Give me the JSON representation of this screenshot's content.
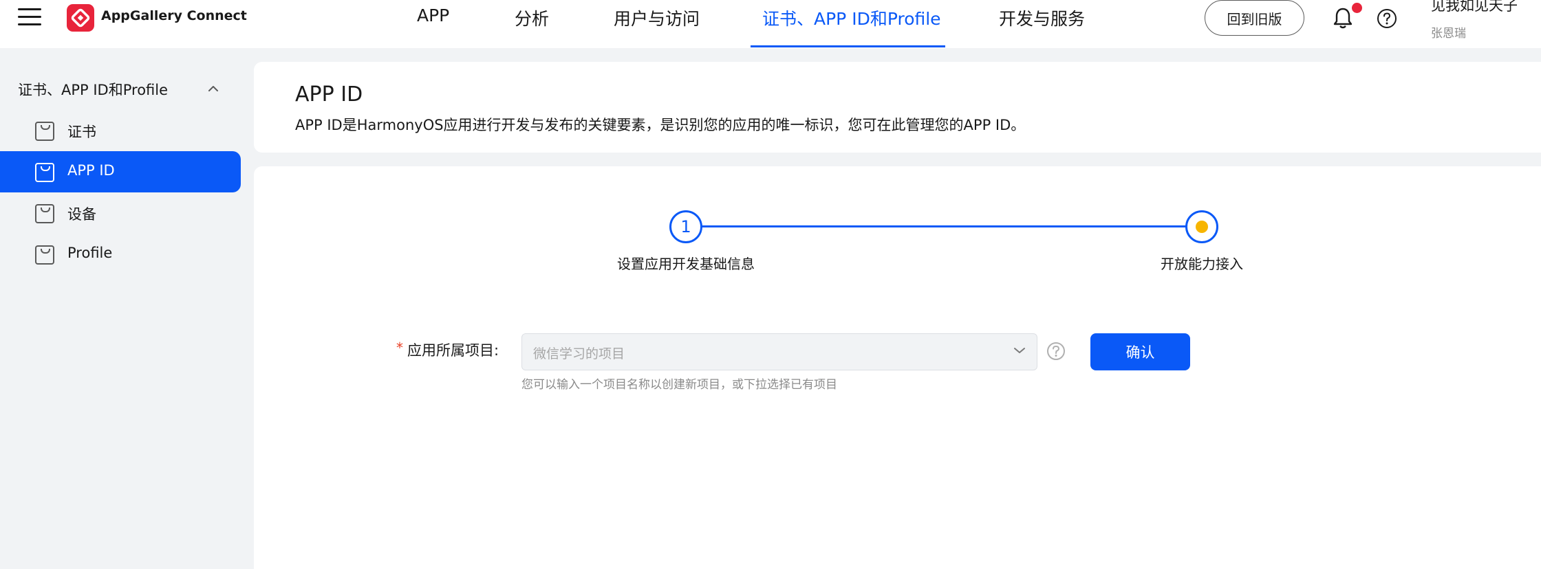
{
  "header": {
    "brand": "AppGallery Connect",
    "nav": [
      {
        "label": "APP"
      },
      {
        "label": "分析"
      },
      {
        "label": "用户与访问"
      },
      {
        "label": "证书、APP ID和Profile",
        "active": true
      },
      {
        "label": "开发与服务"
      }
    ],
    "old_version_label": "回到旧版",
    "user_name": "见我如见天子",
    "user_sub": "张恩瑞",
    "notification_dot_color": "#e8243b"
  },
  "sidebar": {
    "group_label": "证书、APP ID和Profile",
    "items": [
      {
        "label": "证书",
        "icon": "bag-icon"
      },
      {
        "label": "APP ID",
        "icon": "bag-icon",
        "active": true
      },
      {
        "label": "设备",
        "icon": "bag-icon"
      },
      {
        "label": "Profile",
        "icon": "bag-icon"
      }
    ]
  },
  "page": {
    "title": "APP ID",
    "description": "APP ID是HarmonyOS应用进行开发与发布的关键要素，是识别您的应用的唯一标识，您可在此管理您的APP ID。"
  },
  "steps": [
    {
      "number": "1",
      "label": "设置应用开发基础信息",
      "state": "done"
    },
    {
      "label": "开放能力接入",
      "state": "current"
    }
  ],
  "form": {
    "required_mark": "*",
    "project_label": "应用所属项目:",
    "project_placeholder": "微信学习的项目",
    "hint": "您可以输入一个项目名称以创建新项目，或下拉选择已有项目",
    "confirm_label": "确认"
  },
  "colors": {
    "accent": "#0a59f7",
    "current_step_dot": "#f7b500",
    "required": "#e84026"
  }
}
